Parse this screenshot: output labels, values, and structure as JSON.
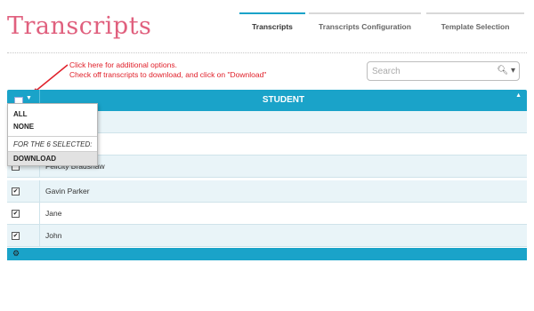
{
  "page": {
    "title": "Transcripts"
  },
  "tabs": [
    {
      "label": "Transcripts",
      "active": true
    },
    {
      "label": "Transcripts Configuration",
      "active": false
    },
    {
      "label": "Template Selection",
      "active": false
    }
  ],
  "annotation": {
    "line1": "Click here for additional options.",
    "line2": "Check off transcripts to download, and click on \"Download\"",
    "color": "#e0202a"
  },
  "search": {
    "placeholder": "Search",
    "value": "",
    "icon": "search-icon",
    "menu_icon": "caret-down-icon"
  },
  "table": {
    "header_label": "STUDENT",
    "header_color": "#1aa3c9",
    "rows": [
      {
        "name": "",
        "checked": false
      },
      {
        "name": "",
        "checked": false
      },
      {
        "name": "Felicity Bradshaw",
        "checked": false
      },
      {
        "name": "Gavin Parker",
        "checked": true
      },
      {
        "name": "Jane",
        "checked": true
      },
      {
        "name": "John",
        "checked": true
      }
    ],
    "footer_icon": "gear-icon"
  },
  "dropdown": {
    "all_label": "ALL",
    "none_label": "NONE",
    "selected_heading": "FOR THE 6 SELECTED:",
    "download_label": "DOWNLOAD"
  },
  "colors": {
    "title": "#e0607e",
    "accent": "#1aa3c9",
    "annotation": "#e0202a"
  }
}
